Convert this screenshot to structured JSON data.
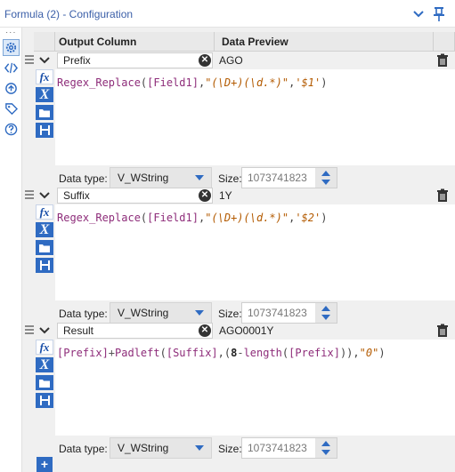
{
  "window": {
    "title": "Formula (2) - Configuration"
  },
  "header": {
    "output_column": "Output Column",
    "data_preview": "Data Preview"
  },
  "rows": [
    {
      "name": "Prefix",
      "preview": "AGO",
      "data_type": "V_WString",
      "size": "1073741823",
      "expr": [
        {
          "c": "tok-fn",
          "t": "Regex_Replace"
        },
        {
          "c": "tok-p",
          "t": "("
        },
        {
          "c": "tok-field",
          "t": "[Field1]"
        },
        {
          "c": "tok-p",
          "t": ","
        },
        {
          "c": "tok-str",
          "t": "\"(\\D+)(\\d.*)\""
        },
        {
          "c": "tok-p",
          "t": ","
        },
        {
          "c": "tok-str",
          "t": "'$1'"
        },
        {
          "c": "tok-p",
          "t": ")"
        }
      ]
    },
    {
      "name": "Suffix",
      "preview": "1Y",
      "data_type": "V_WString",
      "size": "1073741823",
      "expr": [
        {
          "c": "tok-fn",
          "t": "Regex_Replace"
        },
        {
          "c": "tok-p",
          "t": "("
        },
        {
          "c": "tok-field",
          "t": "[Field1]"
        },
        {
          "c": "tok-p",
          "t": ","
        },
        {
          "c": "tok-str",
          "t": "\"(\\D+)(\\d.*)\""
        },
        {
          "c": "tok-p",
          "t": ","
        },
        {
          "c": "tok-str",
          "t": "'$2'"
        },
        {
          "c": "tok-p",
          "t": ")"
        }
      ]
    },
    {
      "name": "Result",
      "preview": "AGO0001Y",
      "data_type": "V_WString",
      "size": "1073741823",
      "expr": [
        {
          "c": "tok-field",
          "t": "[Prefix]"
        },
        {
          "c": "tok-op",
          "t": "+"
        },
        {
          "c": "tok-fn",
          "t": "Padleft"
        },
        {
          "c": "tok-p",
          "t": "("
        },
        {
          "c": "tok-field",
          "t": "[Suffix]"
        },
        {
          "c": "tok-p",
          "t": ",("
        },
        {
          "c": "tok-num",
          "t": "8"
        },
        {
          "c": "tok-op",
          "t": "-"
        },
        {
          "c": "tok-fn",
          "t": "length"
        },
        {
          "c": "tok-p",
          "t": "("
        },
        {
          "c": "tok-field",
          "t": "[Prefix]"
        },
        {
          "c": "tok-p",
          "t": ")),"
        },
        {
          "c": "tok-str",
          "t": "\"0\""
        },
        {
          "c": "tok-p",
          "t": ")"
        }
      ]
    }
  ],
  "labels": {
    "data_type": "Data type:",
    "size": "Size:"
  },
  "add_label": "+",
  "tool_fx": "fx",
  "tool_var": "X",
  "clear_glyph": "✕",
  "sidebar_icons": [
    "gear-icon",
    "code-icon",
    "cycle-icon",
    "tag-icon",
    "help-icon"
  ],
  "accent": "#2f6bc2"
}
